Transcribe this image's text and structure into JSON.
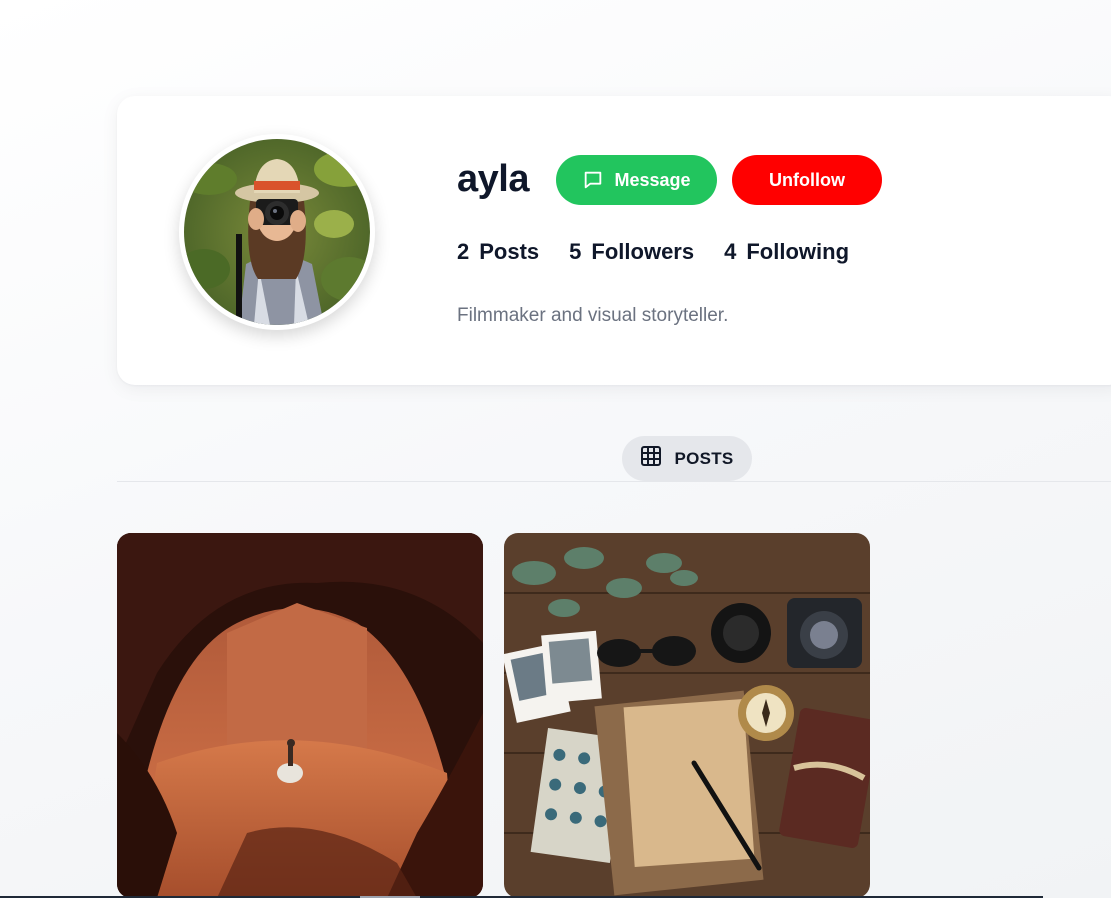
{
  "profile": {
    "username": "ayla",
    "bio": "Filmmaker and visual storyteller.",
    "avatar_icon": "photographer-avatar",
    "stats": {
      "posts_count": "2",
      "posts_label": "Posts",
      "followers_count": "5",
      "followers_label": "Followers",
      "following_count": "4",
      "following_label": "Following"
    }
  },
  "actions": {
    "message_label": "Message",
    "unfollow_label": "Unfollow",
    "message_color": "#22c55e",
    "unfollow_color": "#ff0000"
  },
  "tabs": {
    "posts_label": "POSTS"
  },
  "posts": [
    {
      "image": "desert-canyon-cave"
    },
    {
      "image": "travel-flatlay-desk"
    }
  ]
}
